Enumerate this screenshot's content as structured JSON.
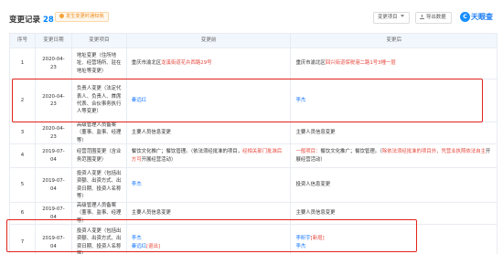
{
  "header": {
    "title": "变更记录",
    "count": "28",
    "badge": "发生变更时通知我",
    "filter_button": "变更项目",
    "export_button": "导出数据",
    "logo_mark": "C",
    "logo_text": "天眼查"
  },
  "table": {
    "columns": [
      "序号",
      "变更日期",
      "变更项目",
      "变更前",
      "变更后"
    ],
    "rows": [
      {
        "index": "1",
        "date": "2020-04-23",
        "item": "地址变更（住所地址、经营场所、驻在地址等变更）",
        "before_plain": "重庆市渝北区",
        "before_red": "龙溪街道花卉西路29号",
        "after_plain": "重庆市渝北区",
        "after_red": "回兴街道保税港二路1号3幢一层"
      },
      {
        "index": "2",
        "date": "2020-04-23",
        "item": "负责人变更（法定代表人、负责人、首席代表、合伙事务执行人等变更）",
        "before_link": "秦远红",
        "after_link": "李杰"
      },
      {
        "index": "3",
        "date": "2020-04-23",
        "item": "高级管理人员备案（董事、监事、经理等）",
        "before_text": "主要人员信息变更",
        "after_text": "主要人员信息变更"
      },
      {
        "index": "4",
        "date": "2019-07-04",
        "item": "经营范围变更（含业务范围变更）",
        "before_a": "餐饮文化推广；餐饮管理。（依法须经批准的项目，",
        "before_red": "经相关部门批准后方可",
        "before_b": "开展经营活动）",
        "after_red_a": "一般项目：",
        "after_a": "餐饮文化推广；餐饮管理。（",
        "after_red_b": "除依法须经批准的项目外，凭营业执照依法自主",
        "after_b": "开展经营活动）"
      },
      {
        "index": "5",
        "date": "2019-07-04",
        "item": "投资人变更（包括出资额、出资方式、出资日期、投资人名称等）",
        "before_link": "李杰",
        "after_text": "投资人信息变更"
      },
      {
        "index": "6",
        "date": "2019-07-04",
        "item": "高级管理人员备案（董事、监事、经理等）",
        "before_text": "主要人员信息变更",
        "after_text": "主要人员信息变更"
      },
      {
        "index": "7",
        "date": "2019-07-04",
        "item": "投资人变更（包括出资额、出资方式、出资日期、投资人名称等）",
        "before_link_1": "李杰",
        "before_link_2": "秦远红",
        "before_tag": "[退出]",
        "after_link_1": "李昕宇",
        "after_tag": "[新增]",
        "after_link_2": "李杰"
      }
    ]
  },
  "colors": {
    "accent": "#1677ff",
    "highlight_box": "#e2231a",
    "header_bg": "#f2f7fd",
    "change_red": "#e5483d"
  }
}
